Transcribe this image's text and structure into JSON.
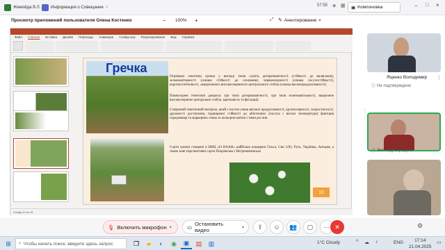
{
  "tabs": [
    {
      "label": "Жемойда В.Л.",
      "color": "#2e7d32"
    },
    {
      "label": "Информация о Совещание",
      "color": "#5865c9"
    }
  ],
  "status": {
    "time": "57:55",
    "app_button": "Компоновка"
  },
  "sharebar": {
    "title": "Просмотр приложений пользователя Олена Костенко",
    "zoom_minus": "−",
    "zoom": "100%",
    "zoom_plus": "+",
    "annotate": "Аннотирование"
  },
  "ppt": {
    "ribbon_tabs": [
      "Файл",
      "Главная",
      "Вставка",
      "Дизайн",
      "Переходы",
      "Анимация",
      "Слайд-шоу",
      "Рецензирование",
      "Вид",
      "Справка"
    ],
    "statusbar": "Слайд 10 из 24",
    "slide_number": "10"
  },
  "slide": {
    "title": "Гречка",
    "p1": "Отримано генотипи гречки у вигляді типів сушіть детермінантності (стійкості до вилягання), зеленоквітковості (ознаки стійкості до осипання), червонозерності (ознака посухостійкості), короткостебловості, «вкороченого високоозерненого центрального стебла (ознака високопродуктивності).",
    "p2": "Повногорені генетичні джерела: три типи детермінантності, три типи зеленоквітковості, вкорочене високоозернене центральне стебло, картковість та фесціації.",
    "p3": "Створений генетичний матеріал, який є носієм ознак високої продуктивності, крупнозерності, скоростиглості, дружності достигання, підвищеної стійкості до абіотичних (посуха і високі температури) факторів середовища та маркерних ознак за кольором квітки і тими рослин.",
    "p4": "Сорти гречки створені в ННЦ «ІЗ НААН» найбільш поширені Ольга, Син 3/02, Руга, Українка, Антарія, а також нові перспективні сорти Покровська і Нетропавлівська"
  },
  "participants": [
    {
      "name": "Яценко Володимир",
      "status": "Не подтверждено"
    },
    {
      "name": "",
      "status": "Эно подтверждено"
    },
    {
      "name": "",
      "status": ""
    }
  ],
  "controls": {
    "mic": "Включить микрофон",
    "camera": "Остановить видео"
  },
  "taskbar": {
    "search_placeholder": "Чтобы начать поиск, введите здесь запрос",
    "weather": "1°C  Cloudy",
    "lang": "ENG",
    "time": "17:14",
    "date": "21.04.2025"
  }
}
